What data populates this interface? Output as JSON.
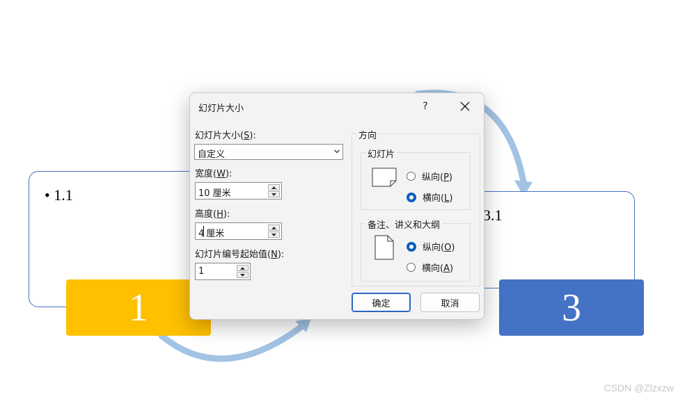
{
  "slide": {
    "box1_bullet": "• 1.1",
    "box3_bullet": "3.1",
    "number1": "1",
    "number3": "3",
    "colors": {
      "gold": "#ffc000",
      "blue": "#4472c4",
      "arrow": "#a3c3e4"
    }
  },
  "watermark": "CSDN @Zlzxzw",
  "dialog": {
    "title": "幻灯片大小",
    "help_label": "?",
    "slide_size_label_pre": "幻灯片大小(",
    "slide_size_label_key": "S",
    "slide_size_label_post": "):",
    "slide_size_value": "自定义",
    "width_label_pre": "宽度(",
    "width_label_key": "W",
    "width_label_post": "):",
    "width_value": "10 厘米",
    "height_label_pre": "高度(",
    "height_label_key": "H",
    "height_label_post": "):",
    "height_value_a": "4",
    "height_value_b": "厘米",
    "start_label_pre": "幻灯片编号起始值(",
    "start_label_key": "N",
    "start_label_post": "):",
    "start_value": "1",
    "orientation_title": "方向",
    "slides_group_title": "幻灯片",
    "slides_portrait_pre": "纵向(",
    "slides_portrait_key": "P",
    "slides_landscape_pre": "横向(",
    "slides_landscape_key": "L",
    "notes_group_title": "备注、讲义和大纲",
    "notes_portrait_pre": "纵向(",
    "notes_portrait_key": "O",
    "notes_landscape_pre": "横向(",
    "notes_landscape_key": "A",
    "close_paren": ")",
    "ok_label": "确定",
    "cancel_label": "取消",
    "slides_selected": "landscape",
    "notes_selected": "portrait"
  }
}
